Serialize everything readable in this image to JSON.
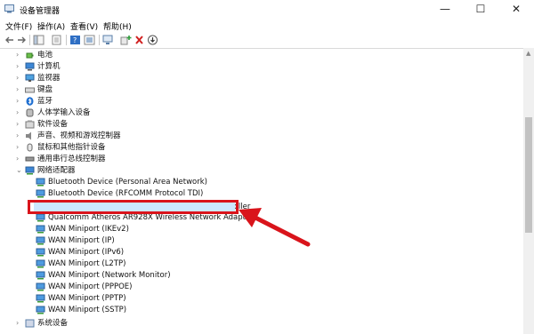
{
  "window": {
    "title": "设备管理器",
    "controls": {
      "minimize": "—",
      "maximize": "☐",
      "close": "✕"
    }
  },
  "menu": [
    "文件(F)",
    "操作(A)",
    "查看(V)",
    "帮助(H)"
  ],
  "tree": {
    "categories_before": [
      "电池",
      "计算机",
      "监视器",
      "键盘",
      "蓝牙",
      "人体学输入设备",
      "软件设备",
      "声音、视频和游戏控制器",
      "鼠标和其他指针设备",
      "通用串行总线控制器"
    ],
    "network_category": "网络适配器",
    "network_devices": [
      "Bluetooth Device (Personal Area Network)",
      "Bluetooth Device (RFCOMM Protocol TDI)",
      "Marvell Yukon 88E8040 PCI-E Fast Ethernet Controller",
      "Qualcomm Atheros AR928X Wireless Network Adapter",
      "WAN Miniport (IKEv2)",
      "WAN Miniport (IP)",
      "WAN Miniport (IPv6)",
      "WAN Miniport (L2TP)",
      "WAN Miniport (Network Monitor)",
      "WAN Miniport (PPPOE)",
      "WAN Miniport (PPTP)",
      "WAN Miniport (SSTP)"
    ],
    "selected_device_index": 2,
    "category_after": "系统设备"
  },
  "colors": {
    "annotation_red": "#d9141b",
    "selection": "#cce8ff"
  }
}
